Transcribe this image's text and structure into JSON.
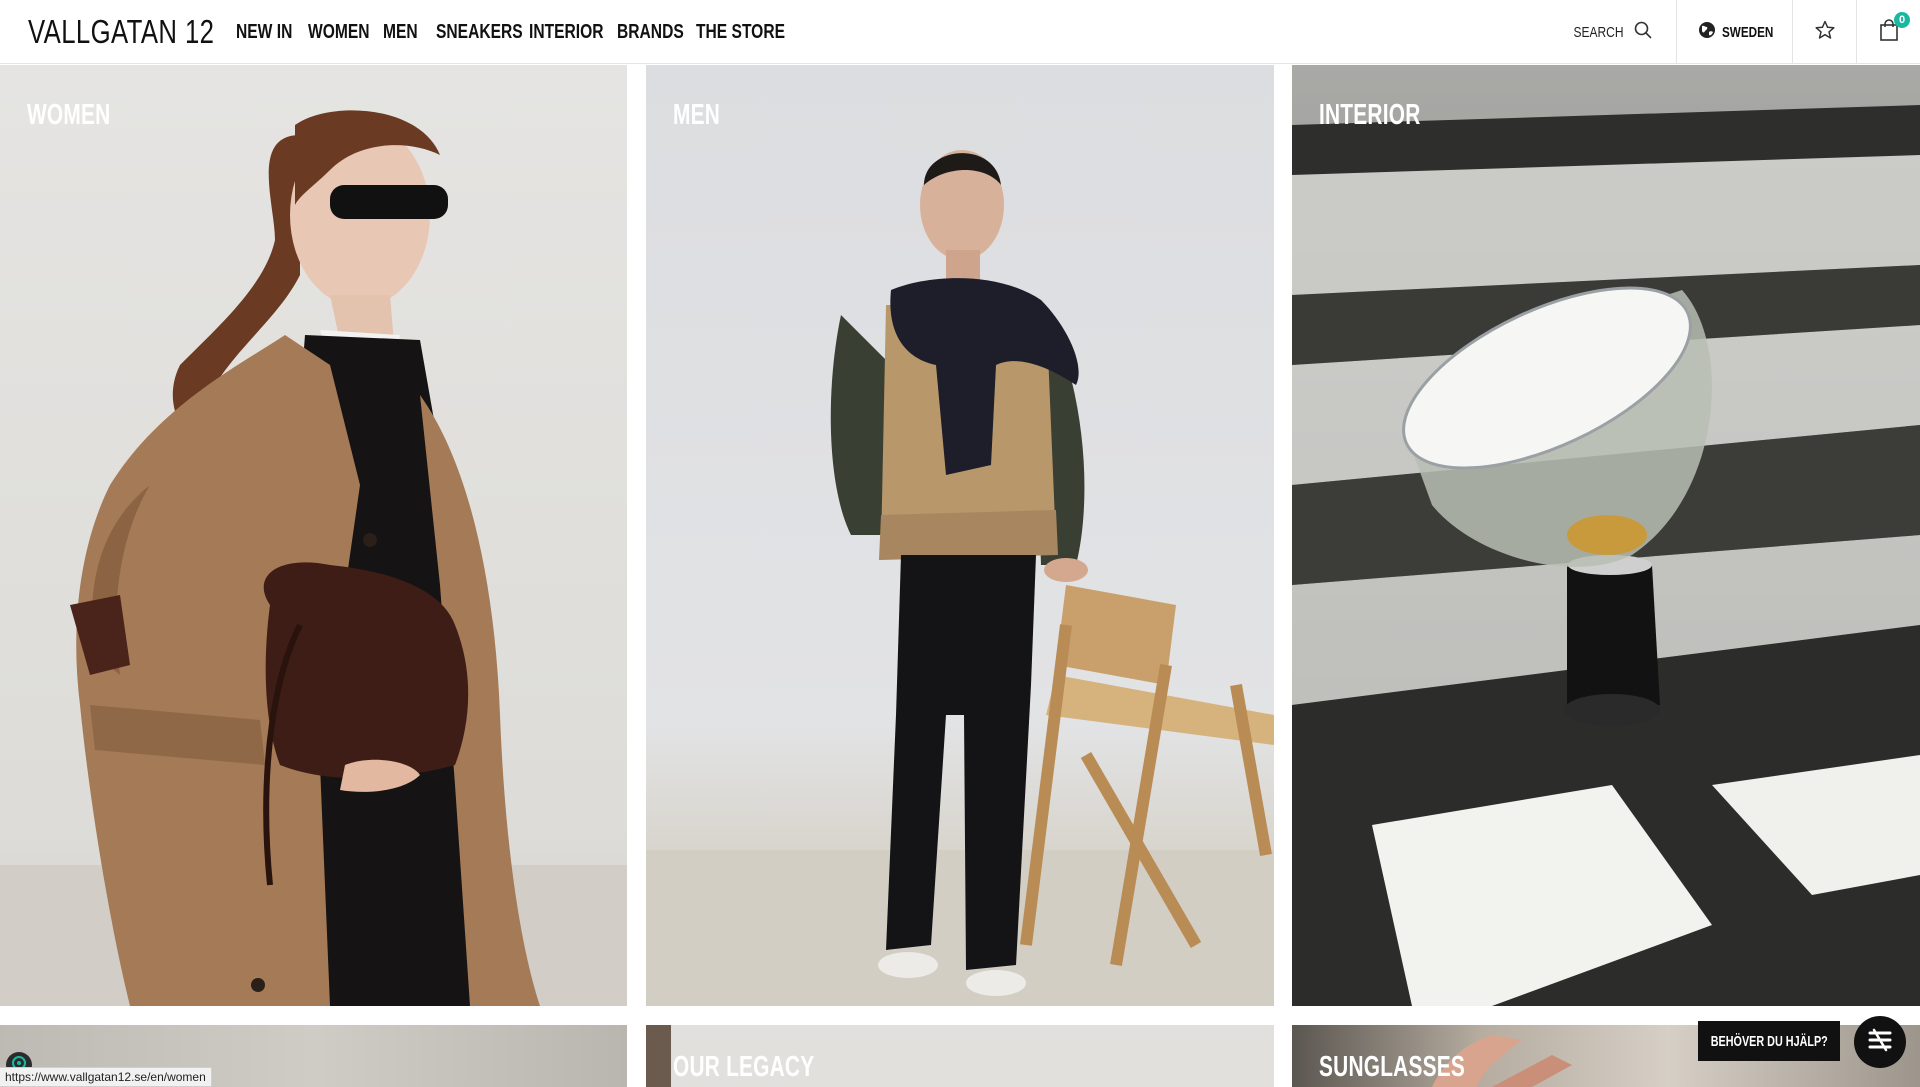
{
  "brand": {
    "logo": "VALLGATAN 12"
  },
  "nav": {
    "items": [
      {
        "label": "NEW IN"
      },
      {
        "label": "WOMEN"
      },
      {
        "label": "MEN"
      },
      {
        "label": "SNEAKERS"
      },
      {
        "label": "INTERIOR"
      },
      {
        "label": "BRANDS"
      },
      {
        "label": "THE STORE"
      }
    ]
  },
  "header": {
    "search_label": "SEARCH",
    "country_label": "SWEDEN",
    "cart_count": "0",
    "icons": {
      "search": "search-icon",
      "globe": "globe-icon",
      "favorites": "star-icon",
      "cart": "shopping-bag-icon"
    },
    "accent_color": "#19b9a1"
  },
  "tiles": {
    "women": {
      "label": "WOMEN"
    },
    "men": {
      "label": "MEN"
    },
    "interior": {
      "label": "INTERIOR"
    },
    "bottom_left": {
      "label": ""
    },
    "our_legacy": {
      "label": "OUR LEGACY"
    },
    "sunglasses": {
      "label": "SUNGLASSES"
    }
  },
  "help": {
    "label": "BEHÖVER DU HJÄLP?"
  },
  "status_bar": {
    "url": "https://www.vallgatan12.se/en/women"
  }
}
